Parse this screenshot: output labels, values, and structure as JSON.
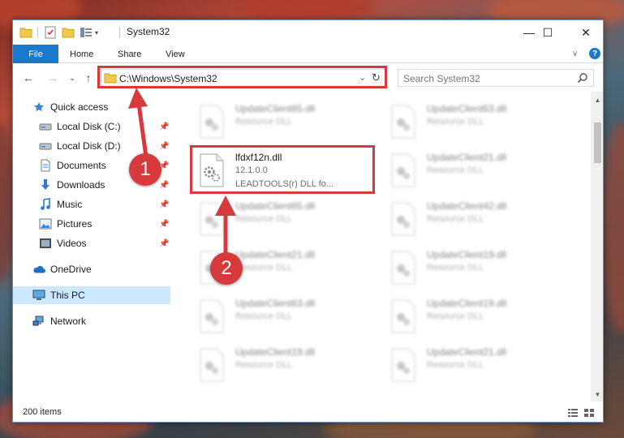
{
  "window": {
    "title": "System32",
    "controls": {
      "minimize": "—",
      "maximize": "☐",
      "close": "✕"
    }
  },
  "ribbon": {
    "tabs": [
      "File",
      "Home",
      "Share",
      "View"
    ],
    "chevron": "∨",
    "help": "?"
  },
  "nav": {
    "address": "C:\\Windows\\System32",
    "search_placeholder": "Search System32"
  },
  "sidebar": {
    "items": [
      {
        "label": "Quick access",
        "icon": "star-icon"
      },
      {
        "label": "Local Disk (C:)",
        "icon": "drive-icon",
        "pinned": true
      },
      {
        "label": "Local Disk (D:)",
        "icon": "drive-icon",
        "pinned": true
      },
      {
        "label": "Documents",
        "icon": "documents-icon",
        "pinned": true
      },
      {
        "label": "Downloads",
        "icon": "downloads-icon",
        "pinned": true
      },
      {
        "label": "Music",
        "icon": "music-icon",
        "pinned": true
      },
      {
        "label": "Pictures",
        "icon": "pictures-icon",
        "pinned": true
      },
      {
        "label": "Videos",
        "icon": "videos-icon",
        "pinned": true
      },
      {
        "label": "OneDrive",
        "icon": "cloud-icon"
      },
      {
        "label": "This PC",
        "icon": "computer-icon",
        "selected": true
      },
      {
        "label": "Network",
        "icon": "network-icon"
      }
    ]
  },
  "files": {
    "featured": {
      "name": "lfdxf12n.dll",
      "version": "12.1.0.0",
      "description": "LEADTOOLS(r) DLL fo..."
    },
    "blurred": [
      {
        "name": "UpdateClient65.dll",
        "type": "Resource DLL"
      },
      {
        "name": "UpdateClient63.dll",
        "type": "Resource DLL"
      },
      {
        "name": "UpdateClient21.dll",
        "type": "Resource DLL"
      },
      {
        "name": "UpdateClient65.dll",
        "type": "Resource DLL"
      },
      {
        "name": "UpdateClient42.dll",
        "type": "Resource DLL"
      },
      {
        "name": "UpdateClient21.dll",
        "type": "Resource DLL"
      },
      {
        "name": "UpdateClient19.dll",
        "type": "Resource DLL"
      },
      {
        "name": "UpdateClient63.dll",
        "type": "Resource DLL"
      },
      {
        "name": "UpdateClient19.dll",
        "type": "Resource DLL"
      },
      {
        "name": "UpdateClient19.dll",
        "type": "Resource DLL"
      },
      {
        "name": "UpdateClient21.dll",
        "type": "Resource DLL"
      }
    ]
  },
  "status": {
    "items_count": "200 items"
  },
  "annotations": {
    "step1": "1",
    "step2": "2",
    "color": "#d9383a"
  }
}
